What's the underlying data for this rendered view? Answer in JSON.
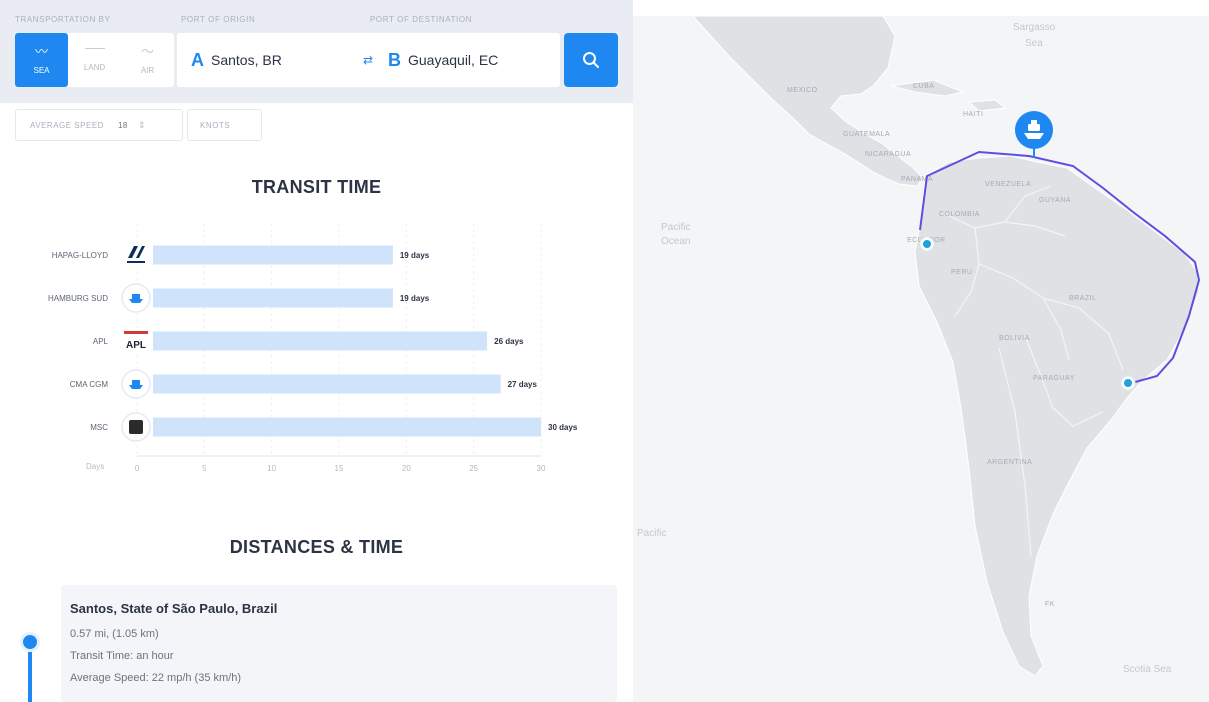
{
  "form": {
    "transport_label": "TRANSPORTATION BY",
    "origin_label": "PORT OF ORIGIN",
    "destination_label": "PORT OF DESTINATION",
    "modes": [
      {
        "label": "SEA",
        "active": true
      },
      {
        "label": "LAND",
        "active": false
      },
      {
        "label": "AIR",
        "active": false
      }
    ],
    "origin_letter": "A",
    "origin_value": "Santos, BR",
    "destination_letter": "B",
    "destination_value": "Guayaquil, EC",
    "speed_label": "AVERAGE SPEED",
    "speed_value": "18",
    "speed_unit": "KNOTS"
  },
  "transit": {
    "title": "TRANSIT TIME",
    "chart_data": {
      "type": "bar",
      "orientation": "horizontal",
      "title": "TRANSIT TIME",
      "categories": [
        "HAPAG-LLOYD",
        "HAMBURG SUD",
        "APL",
        "CMA CGM",
        "MSC"
      ],
      "values": [
        19,
        19,
        26,
        27,
        30
      ],
      "value_labels": [
        "19 days",
        "19 days",
        "26 days",
        "27 days",
        "30 days"
      ],
      "xlabel": "Days",
      "xlim": [
        0,
        30
      ],
      "xticks": [
        "0",
        "5",
        "10",
        "15",
        "20",
        "25",
        "30"
      ],
      "grid": true,
      "bar_color": "#cfe3fb",
      "carrier_icons": [
        "hapag-lloyd-logo",
        "ship-icon",
        "apl-logo",
        "ship-icon",
        "msc-logo"
      ]
    }
  },
  "distances": {
    "title": "DISTANCES & TIME",
    "stops": [
      {
        "name": "Santos, State of São Paulo, Brazil",
        "distance": "0.57 mi, (1.05 km)",
        "transit": "Transit Time: an hour",
        "speed": "Average Speed: 22 mp/h (35 km/h)"
      }
    ]
  },
  "map": {
    "labels": {
      "mexico": "MEXICO",
      "cuba": "CUBA",
      "haiti": "HAITI",
      "guatemala": "GUATEMALA",
      "nicaragua": "NICARAGUA",
      "panama": "PANAMA",
      "venezuela": "VENEZUELA",
      "guyana": "GUYANA",
      "colombia": "COLOMBIA",
      "ecuador": "ECUADOR",
      "peru": "PERU",
      "brazil": "BRAZIL",
      "bolivia": "BOLIVIA",
      "paraguay": "PARAGUAY",
      "argentina": "ARGENTINA",
      "pacific_ocean_1": "Pacific",
      "pacific_ocean_2": "Ocean",
      "pacific_lower": "Pacific",
      "sargasso_1": "Sargasso",
      "sargasso_2": "Sea",
      "scotia": "Scotia Sea",
      "falklands": "FK"
    },
    "route_color": "#5a4fe0",
    "accent_color": "#1e88f0"
  }
}
